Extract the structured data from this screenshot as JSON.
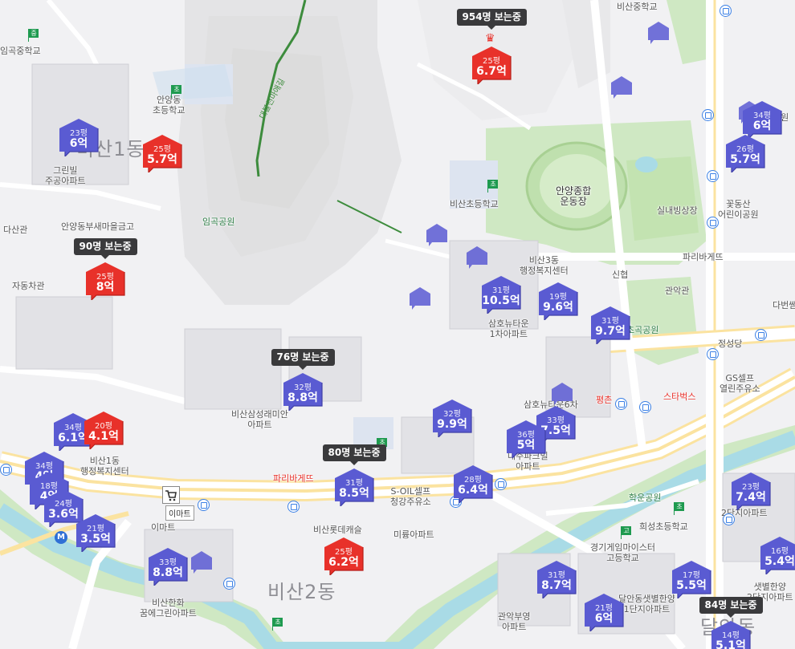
{
  "map": {
    "area_labels": [
      {
        "id": "bisan1",
        "text": "비산1동"
      },
      {
        "id": "bisan2",
        "text": "비산2동"
      },
      {
        "id": "dalan",
        "text": "달안동"
      }
    ],
    "place_labels": [
      {
        "id": "imgok-mid",
        "text": "임곡중학교"
      },
      {
        "id": "anyang-elem",
        "text": "안양동\n초등학교"
      },
      {
        "id": "greenvill",
        "text": "그린빌\n주공아파트"
      },
      {
        "id": "dasan",
        "text": "다산관"
      },
      {
        "id": "saemaeul",
        "text": "안양동부새마을금고"
      },
      {
        "id": "car",
        "text": "자동차관"
      },
      {
        "id": "imgok-park",
        "text": "임곡공원"
      },
      {
        "id": "bisan-elem",
        "text": "비산초등학교"
      },
      {
        "id": "stadium",
        "text": "안양종합\n운동장"
      },
      {
        "id": "ice",
        "text": "실내빙상장"
      },
      {
        "id": "kkot",
        "text": "꽃동산\n어린이공원"
      },
      {
        "id": "bisan-mid",
        "text": "비산중학교"
      },
      {
        "id": "bisan3",
        "text": "비산3동\n행정복지센터"
      },
      {
        "id": "sinhyup",
        "text": "신협"
      },
      {
        "id": "paris1",
        "text": "파리바게뜨"
      },
      {
        "id": "gwanak",
        "text": "관악관"
      },
      {
        "id": "dabeun",
        "text": "다번쌤"
      },
      {
        "id": "samho1",
        "text": "삼호뉴타운\n1차아파트"
      },
      {
        "id": "gokpark",
        "text": "초곡공원"
      },
      {
        "id": "jungseong",
        "text": "정성당"
      },
      {
        "id": "gscell",
        "text": "GS셀프\n열린주유소"
      },
      {
        "id": "samsung",
        "text": "비산삼성래미안\n아파트"
      },
      {
        "id": "samho6",
        "text": "삼호뉴타운6차"
      },
      {
        "id": "pyeongchon",
        "text": "평촌"
      },
      {
        "id": "starbucks",
        "text": "스타벅스"
      },
      {
        "id": "bisan1office",
        "text": "비산1동\n행정복지센터"
      },
      {
        "id": "paris2",
        "text": "파리바게뜨"
      },
      {
        "id": "soil",
        "text": "S-OIL셀프\n청강주유소"
      },
      {
        "id": "hakun",
        "text": "학운공원"
      },
      {
        "id": "emart",
        "text": "이마트"
      },
      {
        "id": "lotte",
        "text": "비산롯데캐슬"
      },
      {
        "id": "mirung",
        "text": "미륭아파트"
      },
      {
        "id": "huiseong",
        "text": "희성초등학교"
      },
      {
        "id": "gyeonggi",
        "text": "경기게임마이스터\n고등학교"
      },
      {
        "id": "hanwha",
        "text": "비산한화\n꿈에그린아파트"
      },
      {
        "id": "gwanakbuyoung",
        "text": "관악부영\n아파트"
      },
      {
        "id": "dalanhanyang",
        "text": "달안동샛별한양\n1단지아파트"
      },
      {
        "id": "saetbyeol",
        "text": "샛별한양\n2단지아파트"
      },
      {
        "id": "seongwon",
        "text": "성원"
      },
      {
        "id": "gwaksan",
        "text": "2단지아파트"
      },
      {
        "id": "jugong2",
        "text": "대주파크빌\n아파트"
      }
    ],
    "trail_label": "대불천마애길"
  },
  "listings": [
    {
      "id": "l1",
      "size": "23평",
      "price": "6억",
      "color": "blue",
      "viewers": ""
    },
    {
      "id": "l2",
      "size": "25평",
      "price": "5.7억",
      "color": "red",
      "viewers": ""
    },
    {
      "id": "l3",
      "size": "25평",
      "price": "8억",
      "color": "red",
      "viewers": "90명 보는중"
    },
    {
      "id": "l4",
      "size": "25평",
      "price": "6.7억",
      "color": "red",
      "viewers": "954명 보는중"
    },
    {
      "id": "l5",
      "size": "34평",
      "price": "6억",
      "color": "blue",
      "viewers": ""
    },
    {
      "id": "l6",
      "size": "26평",
      "price": "5.7억",
      "color": "blue",
      "viewers": ""
    },
    {
      "id": "l7",
      "size": "31평",
      "price": "10.5억",
      "color": "blue",
      "viewers": ""
    },
    {
      "id": "l8",
      "size": "19평",
      "price": "9.6억",
      "color": "blue",
      "viewers": ""
    },
    {
      "id": "l9",
      "size": "31평",
      "price": "9.7억",
      "color": "blue",
      "viewers": ""
    },
    {
      "id": "l10",
      "size": "32평",
      "price": "8.8억",
      "color": "blue",
      "viewers": "76명 보는중"
    },
    {
      "id": "l11",
      "size": "32평",
      "price": "9.9억",
      "color": "blue",
      "viewers": ""
    },
    {
      "id": "l12",
      "size": "33평",
      "price": "7.5억",
      "color": "blue",
      "viewers": ""
    },
    {
      "id": "l13",
      "size": "36평",
      "price": "5억",
      "color": "blue",
      "viewers": ""
    },
    {
      "id": "l14",
      "size": "34평",
      "price": "6.1억",
      "color": "blue",
      "viewers": ""
    },
    {
      "id": "l15",
      "size": "20평",
      "price": "4.1억",
      "color": "red",
      "viewers": ""
    },
    {
      "id": "l16",
      "size": "31평",
      "price": "8.5억",
      "color": "blue",
      "viewers": "80명 보는중"
    },
    {
      "id": "l17",
      "size": "28평",
      "price": "6.4억",
      "color": "blue",
      "viewers": ""
    },
    {
      "id": "l18",
      "size": "34평",
      "price": "4억",
      "color": "blue",
      "viewers": ""
    },
    {
      "id": "l19",
      "size": "18평",
      "price": "4억",
      "color": "blue",
      "viewers": ""
    },
    {
      "id": "l20",
      "size": "24평",
      "price": "3.6억",
      "color": "blue",
      "viewers": ""
    },
    {
      "id": "l21",
      "size": "21평",
      "price": "3.5억",
      "color": "blue",
      "viewers": ""
    },
    {
      "id": "l22",
      "size": "33평",
      "price": "8.8억",
      "color": "blue",
      "viewers": ""
    },
    {
      "id": "l23",
      "size": "25평",
      "price": "6.2억",
      "color": "red",
      "viewers": ""
    },
    {
      "id": "l24",
      "size": "31평",
      "price": "8.7억",
      "color": "blue",
      "viewers": ""
    },
    {
      "id": "l25",
      "size": "21평",
      "price": "6억",
      "color": "blue",
      "viewers": ""
    },
    {
      "id": "l26",
      "size": "17평",
      "price": "5.5억",
      "color": "blue",
      "viewers": ""
    },
    {
      "id": "l27",
      "size": "23평",
      "price": "7.4억",
      "color": "blue",
      "viewers": ""
    },
    {
      "id": "l28",
      "size": "16평",
      "price": "5.4억",
      "color": "blue",
      "viewers": ""
    },
    {
      "id": "l29",
      "size": "14평",
      "price": "5.1억",
      "color": "blue",
      "viewers": "84명 보는중"
    }
  ],
  "colors": {
    "blue": "#5a5bd2",
    "red": "#e8312a",
    "dark_red": "#b81e18",
    "dark_blue": "#3f3fa8",
    "park": "#cfe8c3",
    "river": "#a9dbe6",
    "road": "#ffffff",
    "arterial": "#fbe3a0"
  },
  "pois": {
    "emart_label": "이마트",
    "subway_letter": "M",
    "school_elem": "초",
    "school_mid": "중",
    "school_high": "고"
  }
}
